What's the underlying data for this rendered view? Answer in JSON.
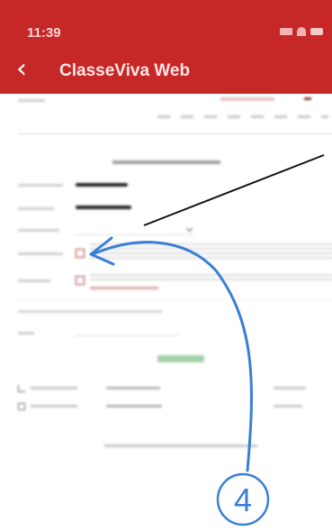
{
  "status_bar": {
    "time": "11:39"
  },
  "nav": {
    "back_icon": "chevron-left-icon",
    "title": "ClasseViva Web"
  },
  "annotation": {
    "circled_number": "4"
  },
  "colors": {
    "header": "#c62828",
    "annotation": "#3a7fd6"
  }
}
